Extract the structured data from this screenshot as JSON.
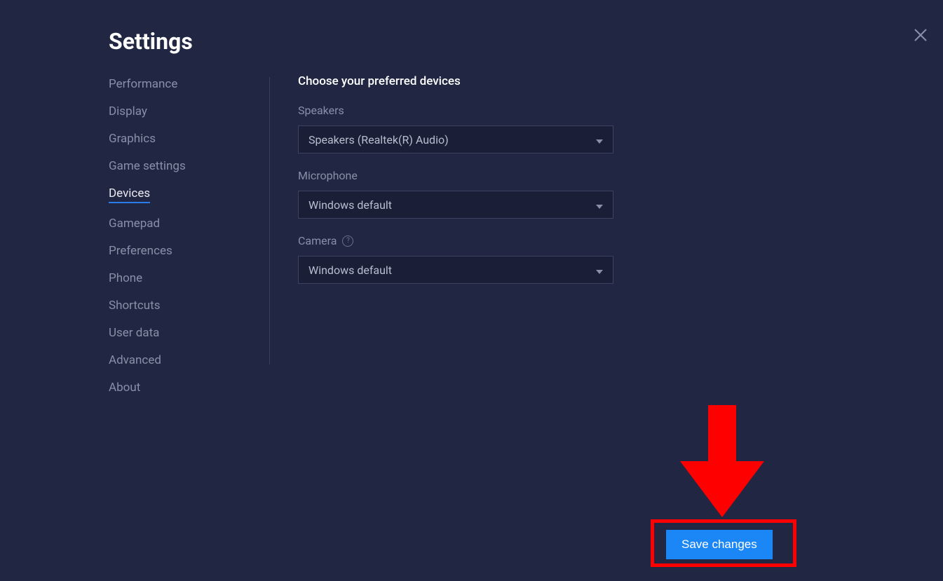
{
  "title": "Settings",
  "sidebar": {
    "items": [
      {
        "label": "Performance",
        "active": false
      },
      {
        "label": "Display",
        "active": false
      },
      {
        "label": "Graphics",
        "active": false
      },
      {
        "label": "Game settings",
        "active": false
      },
      {
        "label": "Devices",
        "active": true
      },
      {
        "label": "Gamepad",
        "active": false
      },
      {
        "label": "Preferences",
        "active": false
      },
      {
        "label": "Phone",
        "active": false
      },
      {
        "label": "Shortcuts",
        "active": false
      },
      {
        "label": "User data",
        "active": false
      },
      {
        "label": "Advanced",
        "active": false
      },
      {
        "label": "About",
        "active": false
      }
    ]
  },
  "content": {
    "section_title": "Choose your preferred devices",
    "speakers": {
      "label": "Speakers",
      "value": "Speakers (Realtek(R) Audio)"
    },
    "microphone": {
      "label": "Microphone",
      "value": "Windows default"
    },
    "camera": {
      "label": "Camera",
      "value": "Windows default"
    }
  },
  "footer": {
    "save_label": "Save changes"
  }
}
